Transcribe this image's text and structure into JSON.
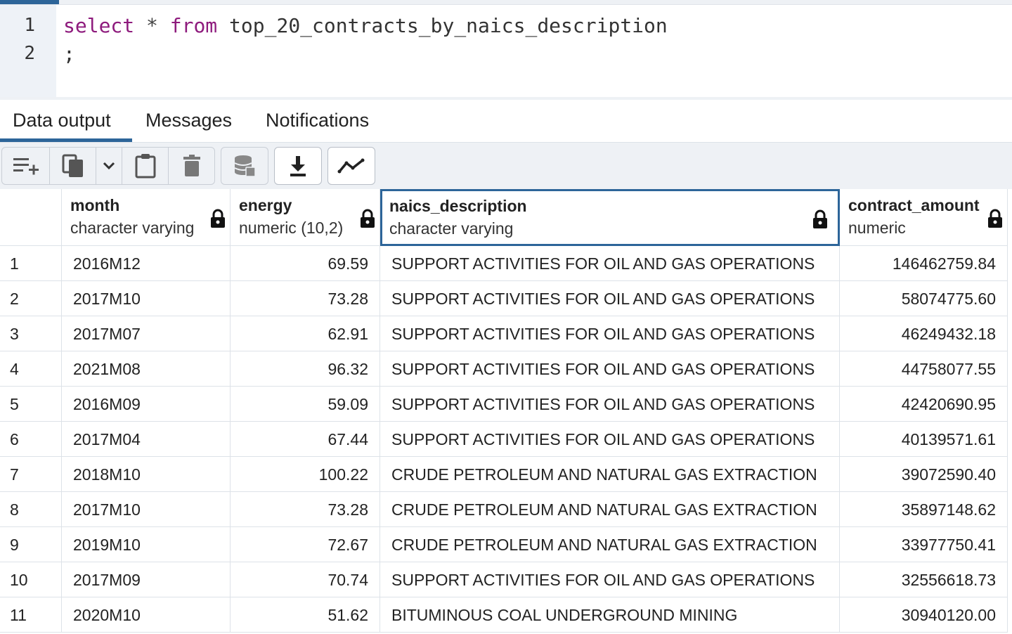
{
  "editor": {
    "line_numbers": [
      "1",
      "2"
    ],
    "line1": {
      "kw1": "select",
      "op": "*",
      "kw2": "from",
      "ident": "top_20_contracts_by_naics_description"
    },
    "line2": ";"
  },
  "tabs": [
    {
      "label": "Data output",
      "active": true
    },
    {
      "label": "Messages",
      "active": false
    },
    {
      "label": "Notifications",
      "active": false
    }
  ],
  "toolbar": {
    "buttons": [
      "add-row-icon",
      "copy-icon",
      "chevron-down-icon",
      "paste-icon",
      "delete-icon",
      "save-data-icon",
      "download-icon",
      "graph-icon"
    ]
  },
  "grid": {
    "columns": [
      {
        "name": "month",
        "type": "character varying"
      },
      {
        "name": "energy",
        "type": "numeric (10,2)"
      },
      {
        "name": "naics_description",
        "type": "character varying"
      },
      {
        "name": "contract_amount",
        "type": "numeric"
      }
    ],
    "rows": [
      {
        "n": "1",
        "month": "2016M12",
        "energy": "69.59",
        "naics": "SUPPORT ACTIVITIES FOR OIL AND GAS OPERATIONS",
        "amount": "146462759.84"
      },
      {
        "n": "2",
        "month": "2017M10",
        "energy": "73.28",
        "naics": "SUPPORT ACTIVITIES FOR OIL AND GAS OPERATIONS",
        "amount": "58074775.60"
      },
      {
        "n": "3",
        "month": "2017M07",
        "energy": "62.91",
        "naics": "SUPPORT ACTIVITIES FOR OIL AND GAS OPERATIONS",
        "amount": "46249432.18"
      },
      {
        "n": "4",
        "month": "2021M08",
        "energy": "96.32",
        "naics": "SUPPORT ACTIVITIES FOR OIL AND GAS OPERATIONS",
        "amount": "44758077.55"
      },
      {
        "n": "5",
        "month": "2016M09",
        "energy": "59.09",
        "naics": "SUPPORT ACTIVITIES FOR OIL AND GAS OPERATIONS",
        "amount": "42420690.95"
      },
      {
        "n": "6",
        "month": "2017M04",
        "energy": "67.44",
        "naics": "SUPPORT ACTIVITIES FOR OIL AND GAS OPERATIONS",
        "amount": "40139571.61"
      },
      {
        "n": "7",
        "month": "2018M10",
        "energy": "100.22",
        "naics": "CRUDE PETROLEUM AND NATURAL GAS EXTRACTION",
        "amount": "39072590.40"
      },
      {
        "n": "8",
        "month": "2017M10",
        "energy": "73.28",
        "naics": "CRUDE PETROLEUM AND NATURAL GAS EXTRACTION",
        "amount": "35897148.62"
      },
      {
        "n": "9",
        "month": "2019M10",
        "energy": "72.67",
        "naics": "CRUDE PETROLEUM AND NATURAL GAS EXTRACTION",
        "amount": "33977750.41"
      },
      {
        "n": "10",
        "month": "2017M09",
        "energy": "70.74",
        "naics": "SUPPORT ACTIVITIES FOR OIL AND GAS OPERATIONS",
        "amount": "32556618.73"
      },
      {
        "n": "11",
        "month": "2020M10",
        "energy": "51.62",
        "naics": "BITUMINOUS COAL UNDERGROUND MINING",
        "amount": "30940120.00"
      }
    ]
  },
  "colors": {
    "accent": "#2d6599",
    "keyword": "#8e1b7d",
    "gutter": "#eef2f7",
    "toolbar_bg": "#eef1f5"
  }
}
